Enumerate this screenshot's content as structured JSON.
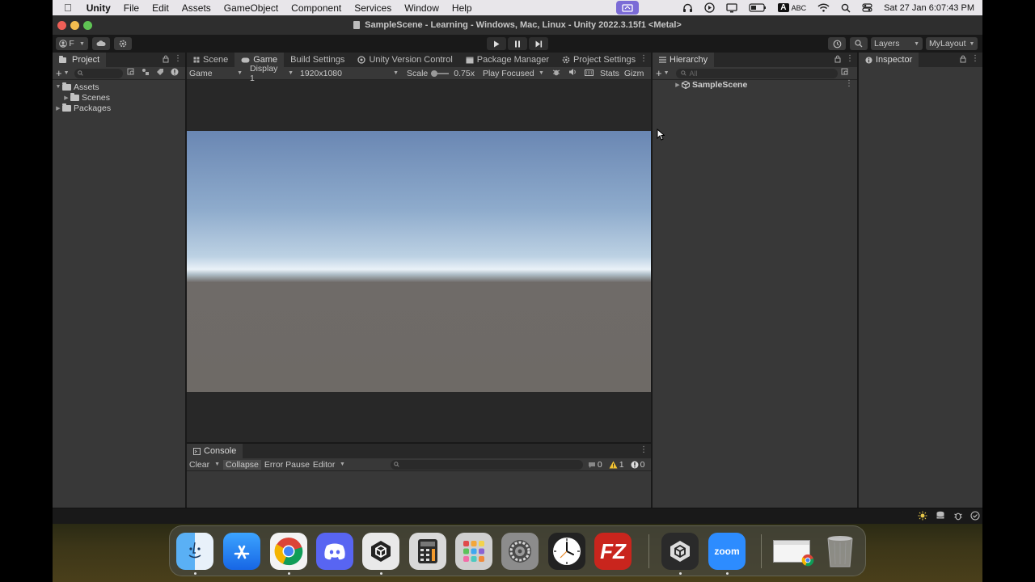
{
  "menubar": {
    "app": "Unity",
    "items": [
      "File",
      "Edit",
      "Assets",
      "GameObject",
      "Component",
      "Services",
      "Window",
      "Help"
    ],
    "input_badge": "A",
    "input_label": "ABC",
    "datetime": "Sat 27 Jan  6:07:43 PM"
  },
  "window": {
    "title": "SampleScene - Learning - Windows, Mac, Linux - Unity 2022.3.15f1 <Metal>"
  },
  "toolbar": {
    "account_label": "F",
    "layers_label": "Layers",
    "layout_label": "MyLayout"
  },
  "project": {
    "tab": "Project",
    "tree": [
      {
        "label": "Assets",
        "depth": 0,
        "expanded": true
      },
      {
        "label": "Scenes",
        "depth": 1,
        "expanded": false
      },
      {
        "label": "Packages",
        "depth": 0,
        "expanded": false
      }
    ]
  },
  "center": {
    "tabs": [
      "Scene",
      "Game",
      "Build Settings",
      "Unity Version Control",
      "Package Manager",
      "Project Settings"
    ],
    "active_tab": "Game",
    "game_bar": {
      "view": "Game",
      "display": "Display 1",
      "resolution": "1920x1080",
      "scale_label": "Scale",
      "scale_value": "0.75x",
      "play_mode": "Play Focused",
      "stats": "Stats",
      "gizmos": "Gizm"
    }
  },
  "console": {
    "tab": "Console",
    "clear": "Clear",
    "collapse": "Collapse",
    "error_pause": "Error Pause",
    "editor": "Editor",
    "log_count": "0",
    "warning_count": "1",
    "error_count": "0"
  },
  "hierarchy": {
    "tab": "Hierarchy",
    "search_placeholder": "All",
    "scene": "SampleScene"
  },
  "inspector": {
    "tab": "Inspector"
  },
  "dock": {
    "apps": [
      "Finder",
      "App Store",
      "Chrome",
      "Discord",
      "Unity Hub",
      "Calculator",
      "Launchpad",
      "System Settings",
      "Clock",
      "FileZilla",
      "Unity",
      "zoom",
      "Chrome Window",
      "Trash"
    ],
    "zoom_label": "zoom",
    "filezilla_label": "FZ"
  },
  "colors": {
    "editor_bg": "#383838",
    "tab_bg": "#282828",
    "sky_top": "#6f8db8",
    "horizon": "#e9f2f8",
    "ground": "#6e6a66"
  }
}
